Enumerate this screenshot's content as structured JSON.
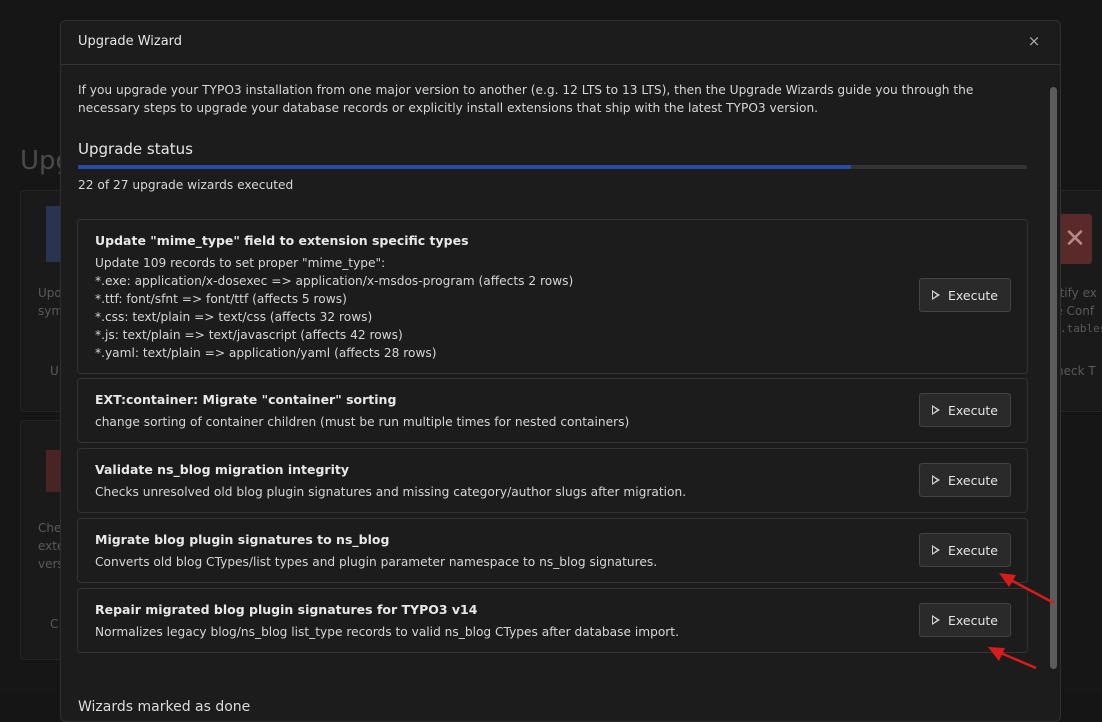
{
  "background": {
    "page_title": "Upg",
    "card_texts": [
      "Upd",
      "sym",
      "U",
      "Che",
      "exte",
      "vers",
      "C",
      "ntify ex",
      "le Conf",
      ".tables",
      "heck T"
    ]
  },
  "modal": {
    "title": "Upgrade Wizard",
    "close_icon": "×",
    "intro": "If you upgrade your TYPO3 installation from one major version to another (e.g. 12 LTS to 13 LTS), then the Upgrade Wizards guide you through the necessary steps to upgrade your database records or explicitly install extensions that ship with the latest TYPO3 version.",
    "status_heading": "Upgrade status",
    "progress": {
      "executed": 22,
      "total": 27,
      "fraction": 0.815,
      "text": "22 of 27 upgrade wizards executed"
    },
    "execute_label": "Execute",
    "wizards": [
      {
        "title": "Update \"mime_type\" field to extension specific types",
        "lines": [
          "Update 109 records to set proper \"mime_type\":",
          "*.exe: application/x-dosexec => application/x-msdos-program (affects 2 rows)",
          "*.ttf: font/sfnt => font/ttf (affects 5 rows)",
          "*.css: text/plain => text/css (affects 32 rows)",
          "*.js: text/plain => text/javascript (affects 42 rows)",
          "*.yaml: text/plain => application/yaml (affects 28 rows)"
        ]
      },
      {
        "title": "EXT:container: Migrate \"container\" sorting",
        "lines": [
          "change sorting of container children (must be run multiple times for nested containers)"
        ]
      },
      {
        "title": "Validate ns_blog migration integrity",
        "lines": [
          "Checks unresolved old blog plugin signatures and missing category/author slugs after migration."
        ]
      },
      {
        "title": "Migrate blog plugin signatures to ns_blog",
        "lines": [
          "Converts old blog CTypes/list types and plugin parameter namespace to ns_blog signatures."
        ]
      },
      {
        "title": "Repair migrated blog plugin signatures for TYPO3 v14",
        "lines": [
          "Normalizes legacy blog/ns_blog list_type records to valid ns_blog CTypes after database import."
        ]
      }
    ],
    "done_heading": "Wizards marked as done"
  },
  "colors": {
    "progress_fill": "#2b4aa6",
    "annotation_arrow": "#d81b1b"
  }
}
